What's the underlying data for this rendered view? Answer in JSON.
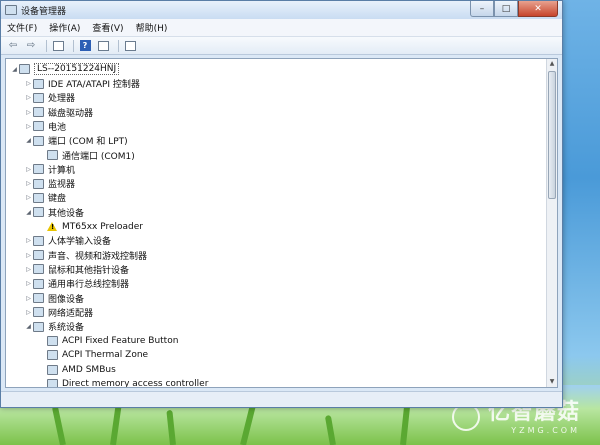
{
  "window": {
    "title": "设备管理器",
    "controls": {
      "minimize": "–",
      "maximize": "□",
      "close": "✕"
    }
  },
  "menubar": {
    "items": [
      "文件(F)",
      "操作(A)",
      "查看(V)",
      "帮助(H)"
    ]
  },
  "toolbar": {
    "back_icon": "⇦",
    "forward_icon": "⇨",
    "help_label": "?"
  },
  "tree": {
    "root": "LS--20151224HNJ",
    "items": [
      {
        "label": "IDE ATA/ATAPI 控制器",
        "level": 1,
        "state": "collapsed",
        "icon": "ide-controller-icon"
      },
      {
        "label": "处理器",
        "level": 1,
        "state": "collapsed",
        "icon": "processor-icon"
      },
      {
        "label": "磁盘驱动器",
        "level": 1,
        "state": "collapsed",
        "icon": "disk-drive-icon"
      },
      {
        "label": "电池",
        "level": 1,
        "state": "collapsed",
        "icon": "battery-icon"
      },
      {
        "label": "端口 (COM 和 LPT)",
        "level": 1,
        "state": "expanded",
        "icon": "port-icon"
      },
      {
        "label": "通信端口 (COM1)",
        "level": 2,
        "state": "leaf",
        "icon": "port-icon"
      },
      {
        "label": "计算机",
        "level": 1,
        "state": "collapsed",
        "icon": "computer-icon"
      },
      {
        "label": "监视器",
        "level": 1,
        "state": "collapsed",
        "icon": "monitor-icon"
      },
      {
        "label": "键盘",
        "level": 1,
        "state": "collapsed",
        "icon": "keyboard-icon"
      },
      {
        "label": "其他设备",
        "level": 1,
        "state": "expanded",
        "icon": "other-devices-icon"
      },
      {
        "label": "MT65xx Preloader",
        "level": 2,
        "state": "leaf",
        "icon": "warning-icon"
      },
      {
        "label": "人体学输入设备",
        "level": 1,
        "state": "collapsed",
        "icon": "hid-icon"
      },
      {
        "label": "声音、视频和游戏控制器",
        "level": 1,
        "state": "collapsed",
        "icon": "sound-icon"
      },
      {
        "label": "鼠标和其他指针设备",
        "level": 1,
        "state": "collapsed",
        "icon": "mouse-icon"
      },
      {
        "label": "通用串行总线控制器",
        "level": 1,
        "state": "collapsed",
        "icon": "usb-icon"
      },
      {
        "label": "图像设备",
        "level": 1,
        "state": "collapsed",
        "icon": "imaging-icon"
      },
      {
        "label": "网络适配器",
        "level": 1,
        "state": "collapsed",
        "icon": "network-adapter-icon"
      },
      {
        "label": "系统设备",
        "level": 1,
        "state": "expanded",
        "icon": "system-devices-icon"
      },
      {
        "label": "ACPI Fixed Feature Button",
        "level": 2,
        "state": "leaf",
        "icon": "system-device-icon"
      },
      {
        "label": "ACPI Thermal Zone",
        "level": 2,
        "state": "leaf",
        "icon": "system-device-icon"
      },
      {
        "label": "AMD SMBus",
        "level": 2,
        "state": "leaf",
        "icon": "system-device-icon"
      },
      {
        "label": "Direct memory access controller",
        "level": 2,
        "state": "leaf",
        "icon": "system-device-icon"
      }
    ]
  },
  "watermark": {
    "text": "亿智蘑菇",
    "sub": "YZMG.COM"
  }
}
